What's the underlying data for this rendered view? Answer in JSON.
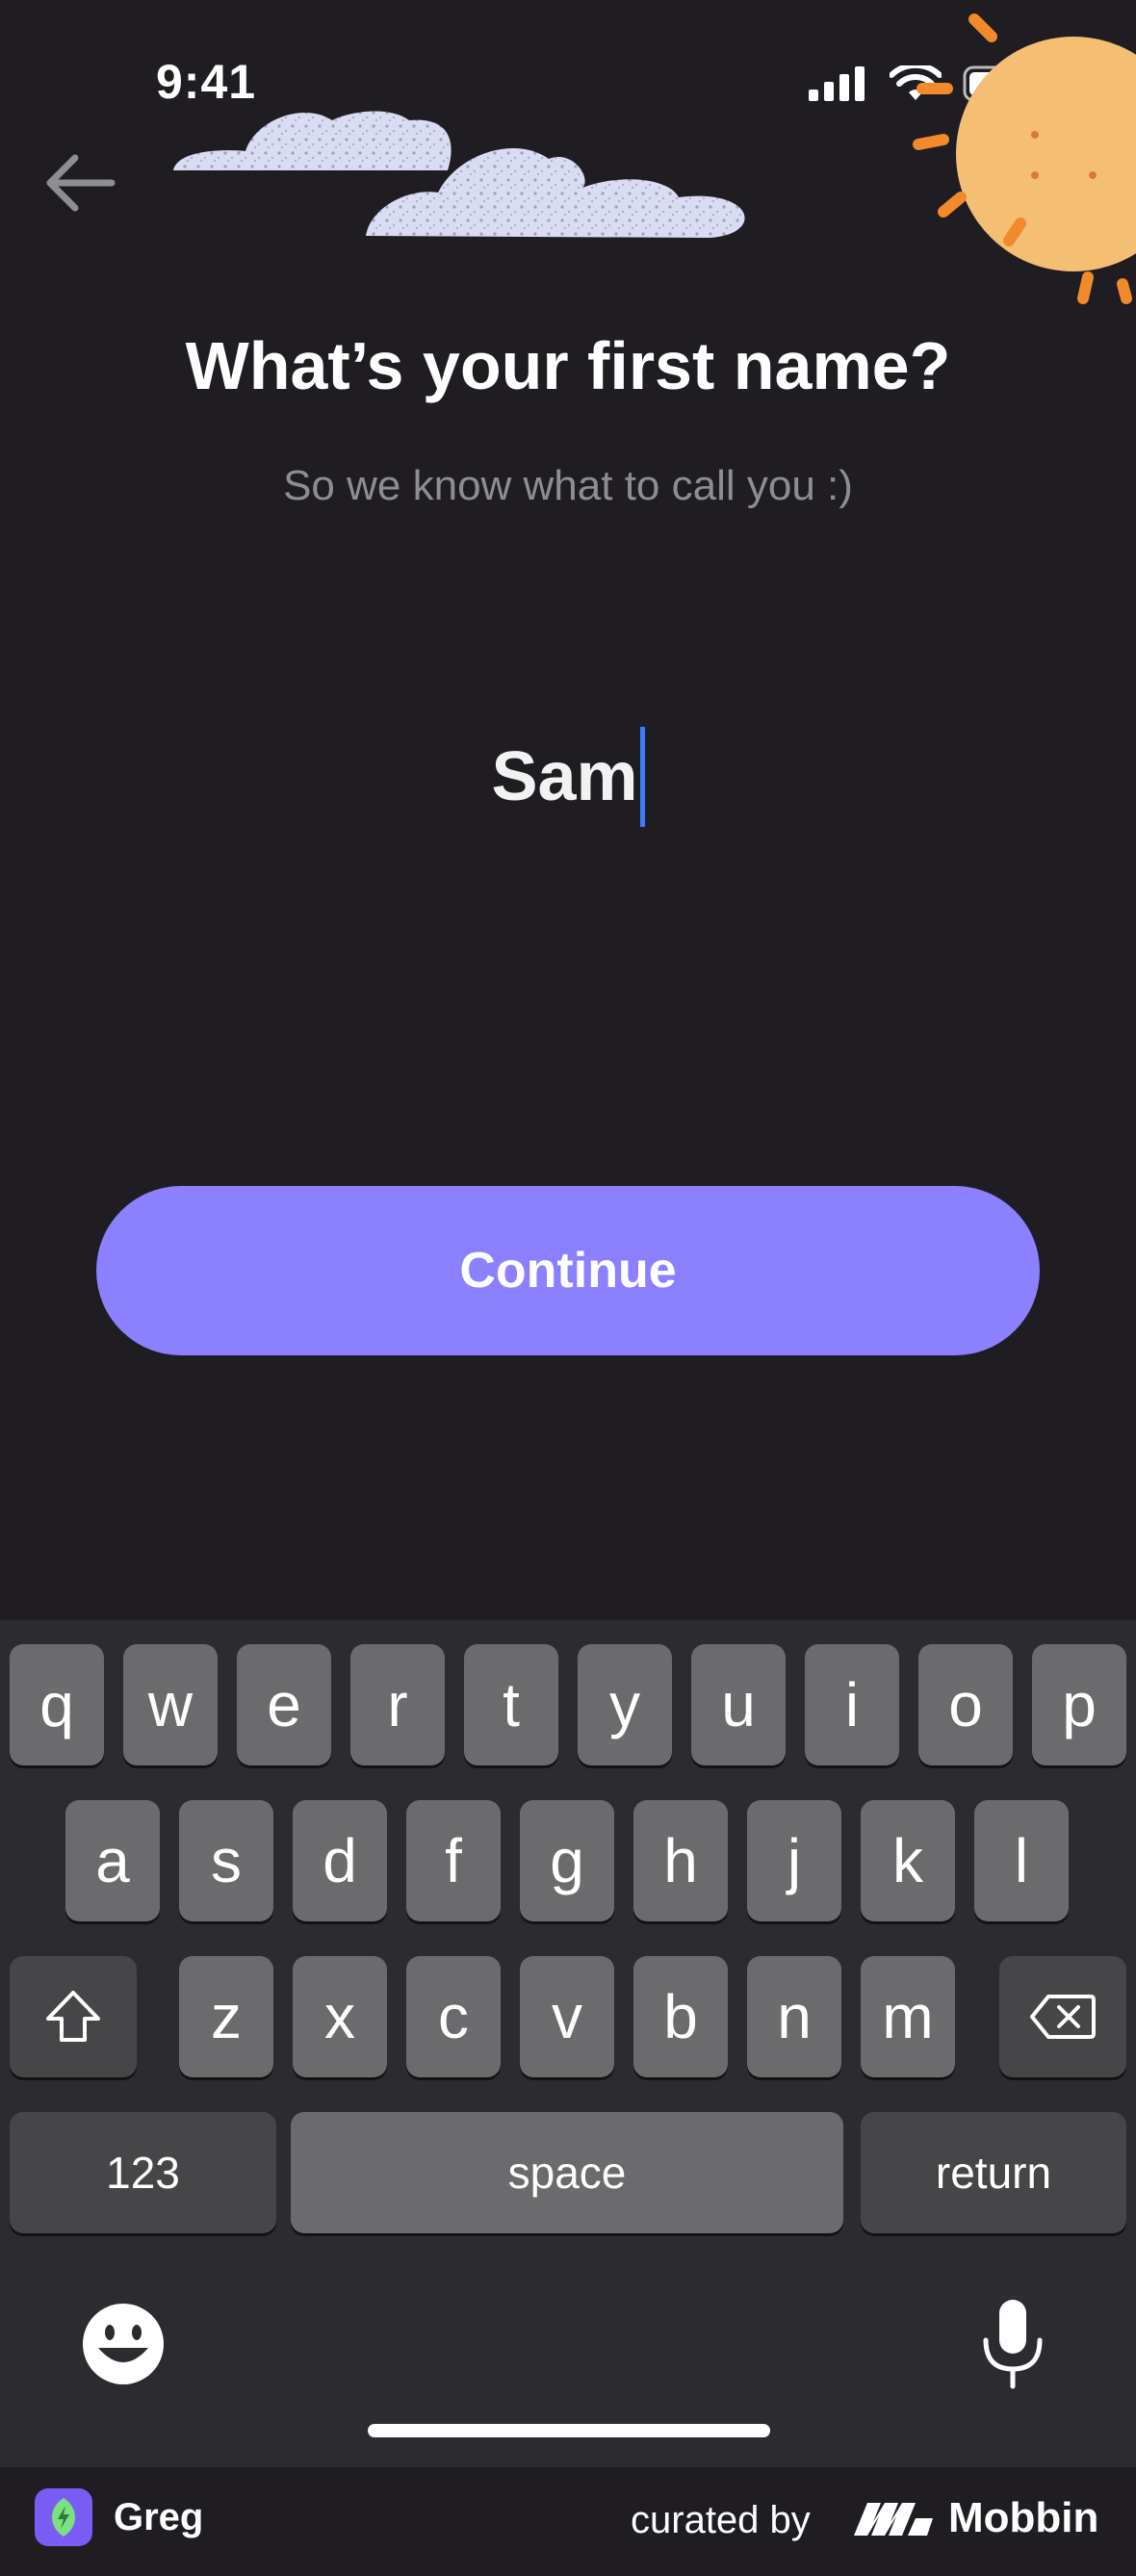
{
  "status_bar": {
    "time": "9:41"
  },
  "header": {
    "back_icon": "arrow-left-icon"
  },
  "main": {
    "title": "What’s your first name?",
    "subtitle": "So we know what to call you :)",
    "name_value": "Sam",
    "continue_label": "Continue"
  },
  "keyboard": {
    "row1": [
      "q",
      "w",
      "e",
      "r",
      "t",
      "y",
      "u",
      "i",
      "o",
      "p"
    ],
    "row2": [
      "a",
      "s",
      "d",
      "f",
      "g",
      "h",
      "j",
      "k",
      "l"
    ],
    "row3": [
      "z",
      "x",
      "c",
      "v",
      "b",
      "n",
      "m"
    ],
    "numbers_label": "123",
    "space_label": "space",
    "return_label": "return"
  },
  "footer": {
    "app_name": "Greg",
    "curated_by": "curated by",
    "brand": "Mobbin"
  },
  "colors": {
    "background": "#1f1d22",
    "accent": "#8b80ff",
    "caret": "#3a7bff"
  }
}
